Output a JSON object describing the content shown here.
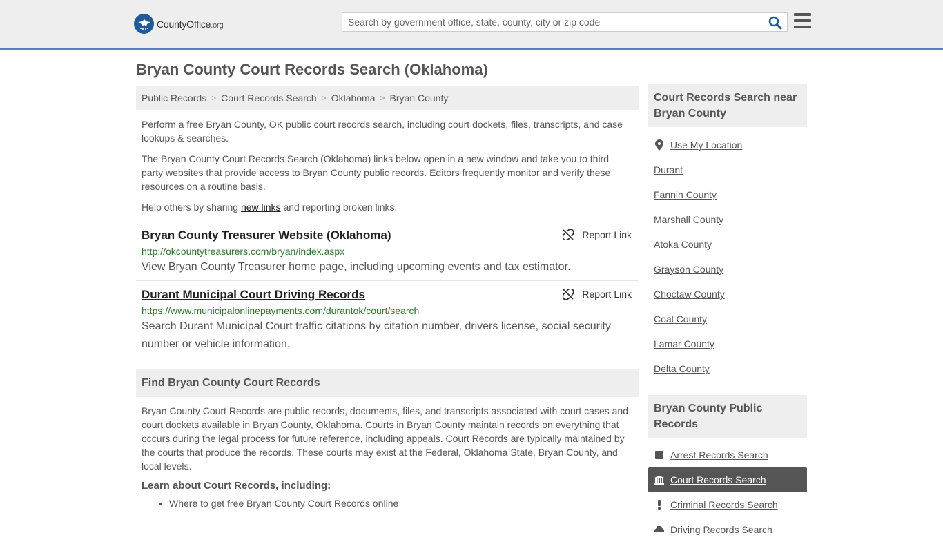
{
  "header": {
    "logo_text": "CountyOffice",
    "logo_suffix": ".org",
    "search_placeholder": "Search by government office, state, county, city or zip code"
  },
  "page_title": "Bryan County Court Records Search (Oklahoma)",
  "breadcrumb": [
    "Public Records",
    "Court Records Search",
    "Oklahoma",
    "Bryan County"
  ],
  "intro": {
    "p1": "Perform a free Bryan County, OK public court records search, including court dockets, files, transcripts, and case lookups & searches.",
    "p2": "The Bryan County Court Records Search (Oklahoma) links below open in a new window and take you to third party websites that provide access to Bryan County public records. Editors frequently monitor and verify these resources on a routine basis.",
    "p3_before": "Help others by sharing ",
    "p3_link": "new links",
    "p3_after": " and reporting broken links."
  },
  "results": [
    {
      "title": "Bryan County Treasurer Website (Oklahoma)",
      "url": "http://okcountytreasurers.com/bryan/index.aspx",
      "desc": "View Bryan County Treasurer home page, including upcoming events and tax estimator.",
      "report_label": "Report Link"
    },
    {
      "title": "Durant Municipal Court Driving Records",
      "url": "https://www.municipalonlinepayments.com/durantok/court/search",
      "desc": "Search Durant Municipal Court traffic citations by citation number, drivers license, social security number or vehicle information.",
      "report_label": "Report Link"
    }
  ],
  "find_section": {
    "title": "Find Bryan County Court Records",
    "body": "Bryan County Court Records are public records, documents, files, and transcripts associated with court cases and court dockets available in Bryan County, Oklahoma. Courts in Bryan County maintain records on everything that occurs during the legal process for future reference, including appeals. Court Records are typically maintained by the courts that produce the records. These courts may exist at the Federal, Oklahoma State, Bryan County, and local levels.",
    "learn_title": "Learn about Court Records, including:",
    "learn_items": [
      "Where to get free Bryan County Court Records online"
    ]
  },
  "sidebar": {
    "near_title": "Court Records Search near Bryan County",
    "use_location": "Use My Location",
    "near_items": [
      "Durant",
      "Fannin County",
      "Marshall County",
      "Atoka County",
      "Grayson County",
      "Choctaw County",
      "Coal County",
      "Lamar County",
      "Delta County"
    ],
    "public_title": "Bryan County Public Records",
    "public_items": [
      {
        "label": "Arrest Records Search",
        "icon": "square-icon"
      },
      {
        "label": "Court Records Search",
        "icon": "courthouse-icon",
        "active": true
      },
      {
        "label": "Criminal Records Search",
        "icon": "exclamation-icon"
      },
      {
        "label": "Driving Records Search",
        "icon": "car-icon"
      }
    ]
  },
  "colors": {
    "header_bg": "#eeeeee",
    "header_border": "#4a86c5",
    "url_green": "#2a7a2a",
    "active_item_bg": "#555555",
    "logo_blue": "#1f5b9b"
  }
}
